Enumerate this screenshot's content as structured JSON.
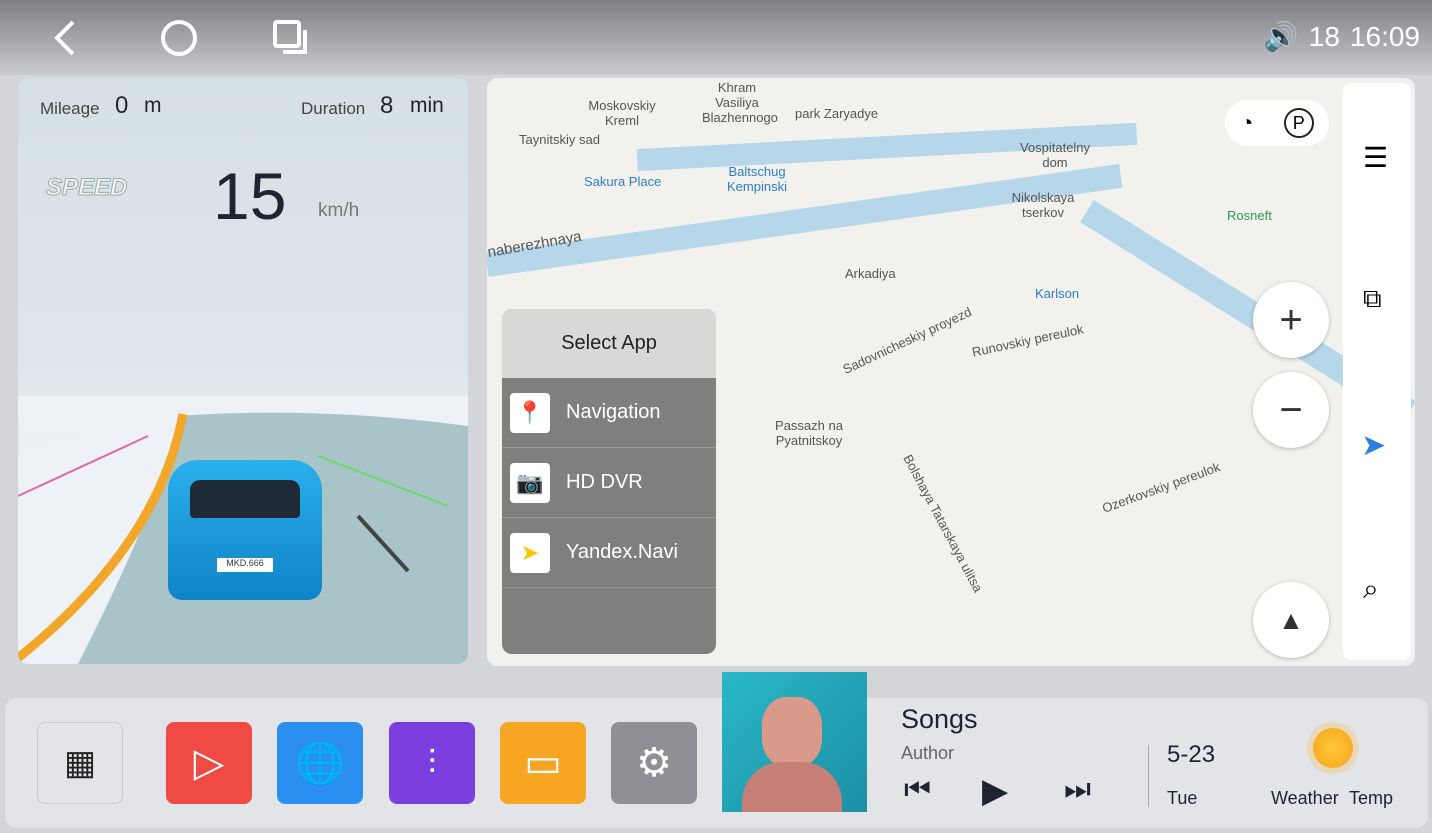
{
  "status": {
    "volume_icon": "speaker-icon",
    "volume": "18",
    "time": "16:09"
  },
  "nav": {
    "back_icon": "back-icon",
    "home_icon": "home-icon",
    "recents_icon": "recents-icon"
  },
  "drive": {
    "mileage_label": "Mileage",
    "mileage_value": "0",
    "mileage_unit": "m",
    "duration_label": "Duration",
    "duration_value": "8",
    "duration_unit": "min",
    "speed_logo": "SPEED",
    "speed": "15",
    "speed_unit": "km/h",
    "plate": "MKD.666"
  },
  "map": {
    "labels": [
      "Moskovskiy Kreml",
      "Khram Vasiliya Blazhennogo",
      "park Zaryadye",
      "Taynitskiy sad",
      "Sakura Place",
      "Baltschug Kempinski",
      "Vospitatelny dom",
      "Nikolskaya tserkov",
      "Rosneft",
      "naberezhnaya",
      "Arkadiya",
      "Karlson",
      "Sadovnicheskiy proyezd",
      "Runovskiy pereulok",
      "Passazh na Pyatnitskoy",
      "Bolshaya Tatarskaya ulitsa",
      "Ozerkovskiy pereulok"
    ]
  },
  "dialog": {
    "title": "Select App",
    "options": [
      {
        "label": "Navigation",
        "icon": "google-maps-icon"
      },
      {
        "label": "HD DVR",
        "icon": "camera-icon"
      },
      {
        "label": "Yandex.Navi",
        "icon": "yandex-navi-icon"
      }
    ]
  },
  "music": {
    "title": "Songs",
    "author": "Author"
  },
  "date": {
    "date": "5-23",
    "weekday": "Tue"
  },
  "weather": {
    "label": "Weather",
    "temp": "Temp",
    "icon": "sun-icon"
  },
  "dock": {
    "apps": [
      {
        "icon": "apps-grid-icon",
        "color": "#e3e4e8"
      },
      {
        "icon": "video-player-icon",
        "color": "#f04a45"
      },
      {
        "icon": "browser-globe-icon",
        "color": "#2a8ff0"
      },
      {
        "icon": "equalizer-icon",
        "color": "#7b3fe0"
      },
      {
        "icon": "file-manager-icon",
        "color": "#f6a623"
      },
      {
        "icon": "settings-icon",
        "color": "#8e9096"
      }
    ]
  }
}
